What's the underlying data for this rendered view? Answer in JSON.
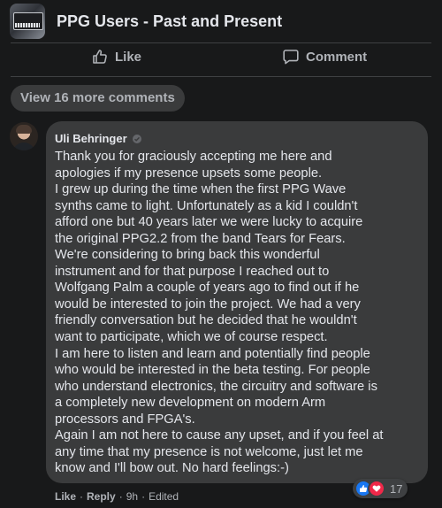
{
  "group": {
    "title": "PPG Users - Past and Present",
    "thumbnail_icon": "synth-group-thumbnail"
  },
  "actions": {
    "like_label": "Like",
    "like_icon": "thumbs-up-icon",
    "comment_label": "Comment",
    "comment_icon": "comment-bubble-icon"
  },
  "view_more": {
    "label": "View 16 more comments"
  },
  "comment": {
    "author": "Uli Behringer",
    "badge_icon": "profile-badge-icon",
    "lines": [
      "Thank you for graciously accepting me here and",
      "apologies if my presence upsets some people.",
      "I grew up during the time when the first PPG Wave",
      "synths came to light. Unfortunately as a kid I couldn't",
      "afford one but 40 years later we were lucky to acquire",
      "the original PPG2.2 from the band Tears for Fears.",
      "We're considering to bring back this wonderful",
      "instrument and for that purpose I reached out to",
      "Wolfgang Palm a couple of years ago to find out if he",
      "would be interested to join the project. We had a very",
      "friendly conversation but he decided that he wouldn't",
      "want to participate, which we of course respect.",
      "I am here to listen and learn and potentially find people",
      "who would be interested in the beta testing. For people",
      "who understand electronics, the circuitry and software is",
      "a completely new development on modern Arm",
      "processors and FPGA's.",
      "Again I am not here to cause any upset, and if you feel at",
      "any time that my presence is not welcome, just let me",
      "know and I'll bow out. No hard feelings:-)"
    ],
    "reactions": {
      "count": "17",
      "icons": [
        "like-reaction-icon",
        "love-reaction-icon"
      ]
    },
    "meta": {
      "like_label": "Like",
      "reply_label": "Reply",
      "time": "9h",
      "edited_label": "Edited",
      "separator": "·"
    }
  },
  "colors": {
    "background": "#18191a",
    "bubble": "#3a3b3c",
    "text_primary": "#e4e6eb",
    "text_secondary": "#b0b3b8",
    "like_blue": "#1877f2",
    "love_red": "#f02849"
  }
}
